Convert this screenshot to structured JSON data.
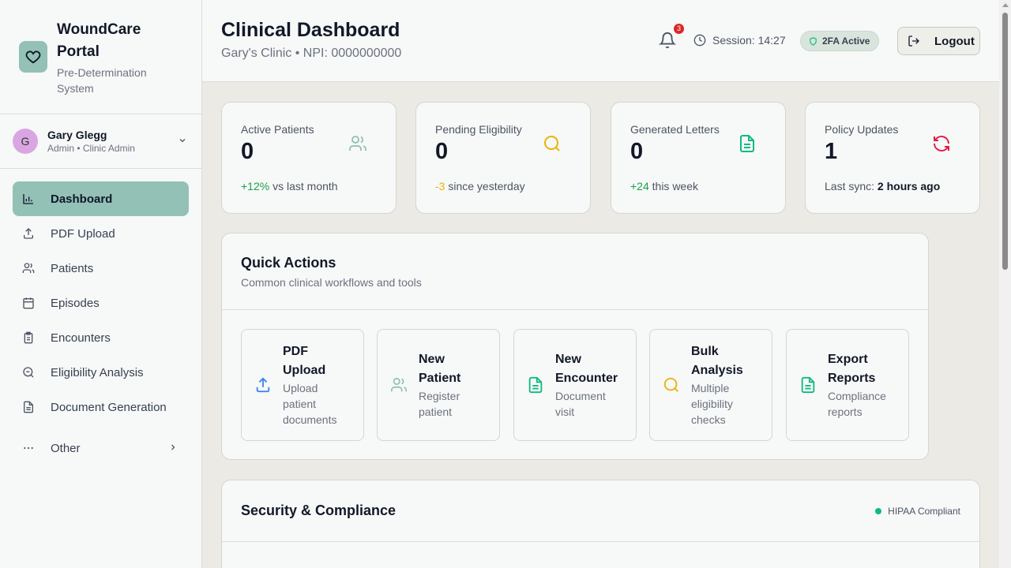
{
  "brand": {
    "title": "WoundCare Portal",
    "subtitle": "Pre-Determination System"
  },
  "user": {
    "initial": "G",
    "name": "Gary Glegg",
    "role": "Admin • Clinic Admin"
  },
  "nav": {
    "items": [
      {
        "label": "Dashboard",
        "icon": "bar-chart-icon",
        "active": true
      },
      {
        "label": "PDF Upload",
        "icon": "upload-icon"
      },
      {
        "label": "Patients",
        "icon": "users-icon"
      },
      {
        "label": "Episodes",
        "icon": "calendar-icon"
      },
      {
        "label": "Encounters",
        "icon": "clipboard-icon"
      },
      {
        "label": "Eligibility Analysis",
        "icon": "search-icon"
      },
      {
        "label": "Document Generation",
        "icon": "document-icon"
      }
    ],
    "other_label": "Other"
  },
  "header": {
    "title": "Clinical Dashboard",
    "subtitle": "Gary's Clinic • NPI: 0000000000",
    "notifications": "3",
    "session": "Session: 14:27",
    "twofa": "2FA Active",
    "logout": "Logout"
  },
  "stats": [
    {
      "label": "Active Patients",
      "value": "0",
      "delta": "+12%",
      "delta_text": "vs last month",
      "delta_color": "#16a34a",
      "icon": "users-icon",
      "icon_color": "#8fbfb2"
    },
    {
      "label": "Pending Eligibility",
      "value": "0",
      "delta": "-3",
      "delta_text": "since yesterday",
      "delta_color": "#eab308",
      "icon": "search-icon",
      "icon_color": "#eab308"
    },
    {
      "label": "Generated Letters",
      "value": "0",
      "delta": "+24",
      "delta_text": "this week",
      "delta_color": "#16a34a",
      "icon": "document-icon",
      "icon_color": "#10b981"
    },
    {
      "label": "Policy Updates",
      "value": "1",
      "foot_label": "Last sync:",
      "foot_value": "2 hours ago",
      "icon": "refresh-icon",
      "icon_color": "#e11d48"
    }
  ],
  "quick_actions": {
    "title": "Quick Actions",
    "subtitle": "Common clinical workflows and tools",
    "items": [
      {
        "title": "PDF Upload",
        "desc": "Upload patient documents",
        "icon": "upload-icon",
        "color": "#3b82f6"
      },
      {
        "title": "New Patient",
        "desc": "Register patient",
        "icon": "users-icon",
        "color": "#8fbfb2"
      },
      {
        "title": "New Encounter",
        "desc": "Document visit",
        "icon": "document-icon",
        "color": "#10b981"
      },
      {
        "title": "Bulk Analysis",
        "desc": "Multiple eligibility checks",
        "icon": "search-icon",
        "color": "#eab308"
      },
      {
        "title": "Export Reports",
        "desc": "Compliance reports",
        "icon": "document-icon",
        "color": "#10b981"
      }
    ]
  },
  "security": {
    "title": "Security & Compliance",
    "badge": "HIPAA Compliant"
  }
}
